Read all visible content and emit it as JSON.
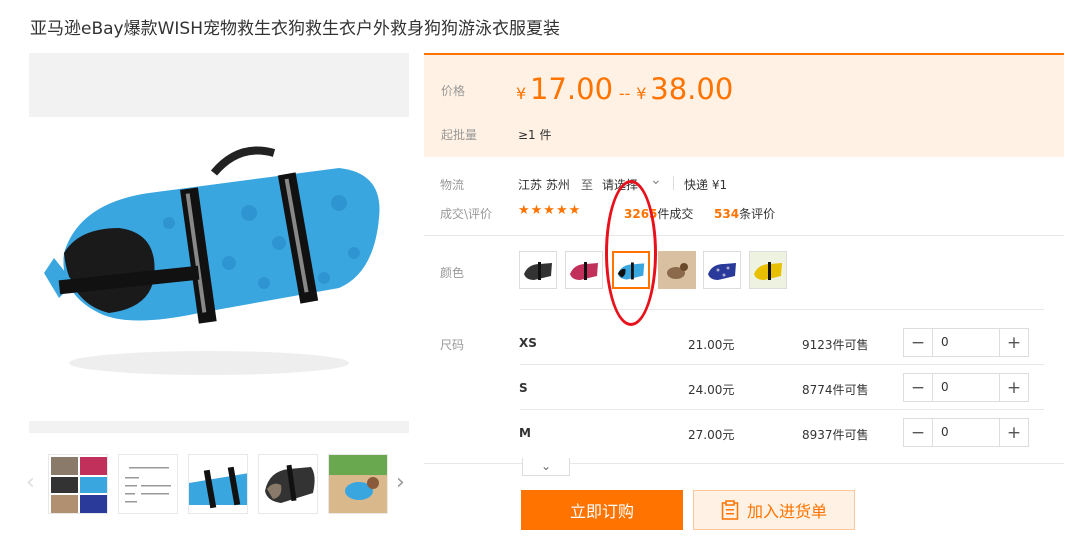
{
  "title": "亚马逊eBay爆款WISH宠物救生衣狗救生衣户外救身狗狗游泳衣服夏装",
  "price": {
    "label": "价格",
    "currency": "¥",
    "min": "17.00",
    "separator": "--",
    "max": "38.00",
    "moq_label": "起批量",
    "moq_value": "≥1 件"
  },
  "shipping": {
    "label": "物流",
    "from": "江苏 苏州",
    "to_word": "至",
    "to_select": "请选择",
    "method": "快递 ¥1"
  },
  "deals": {
    "label": "成交\\评价",
    "stars": "★★★★★",
    "sold_count": "3265",
    "sold_suffix": "件成交",
    "review_count": "534",
    "review_suffix": "条评价"
  },
  "color": {
    "label": "颜色",
    "options": [
      "black",
      "rose",
      "blue",
      "photo",
      "navy",
      "yellow"
    ],
    "selected_index": 2
  },
  "size": {
    "label": "尺码",
    "rows": [
      {
        "name": "XS",
        "price": "21.00元",
        "stock": "9123件可售",
        "qty": "0"
      },
      {
        "name": "S",
        "price": "24.00元",
        "stock": "8774件可售",
        "qty": "0"
      },
      {
        "name": "M",
        "price": "27.00元",
        "stock": "8937件可售",
        "qty": "0"
      }
    ]
  },
  "actions": {
    "buy": "立即订购",
    "cart": "加入进货单"
  },
  "icons": {
    "minus": "−",
    "plus": "+",
    "expand": "⌄",
    "prev": "‹",
    "next": "›"
  },
  "colors": {
    "accent": "#ff7300",
    "price_bg": "#fff1e3",
    "annotation": "#e8101a"
  }
}
